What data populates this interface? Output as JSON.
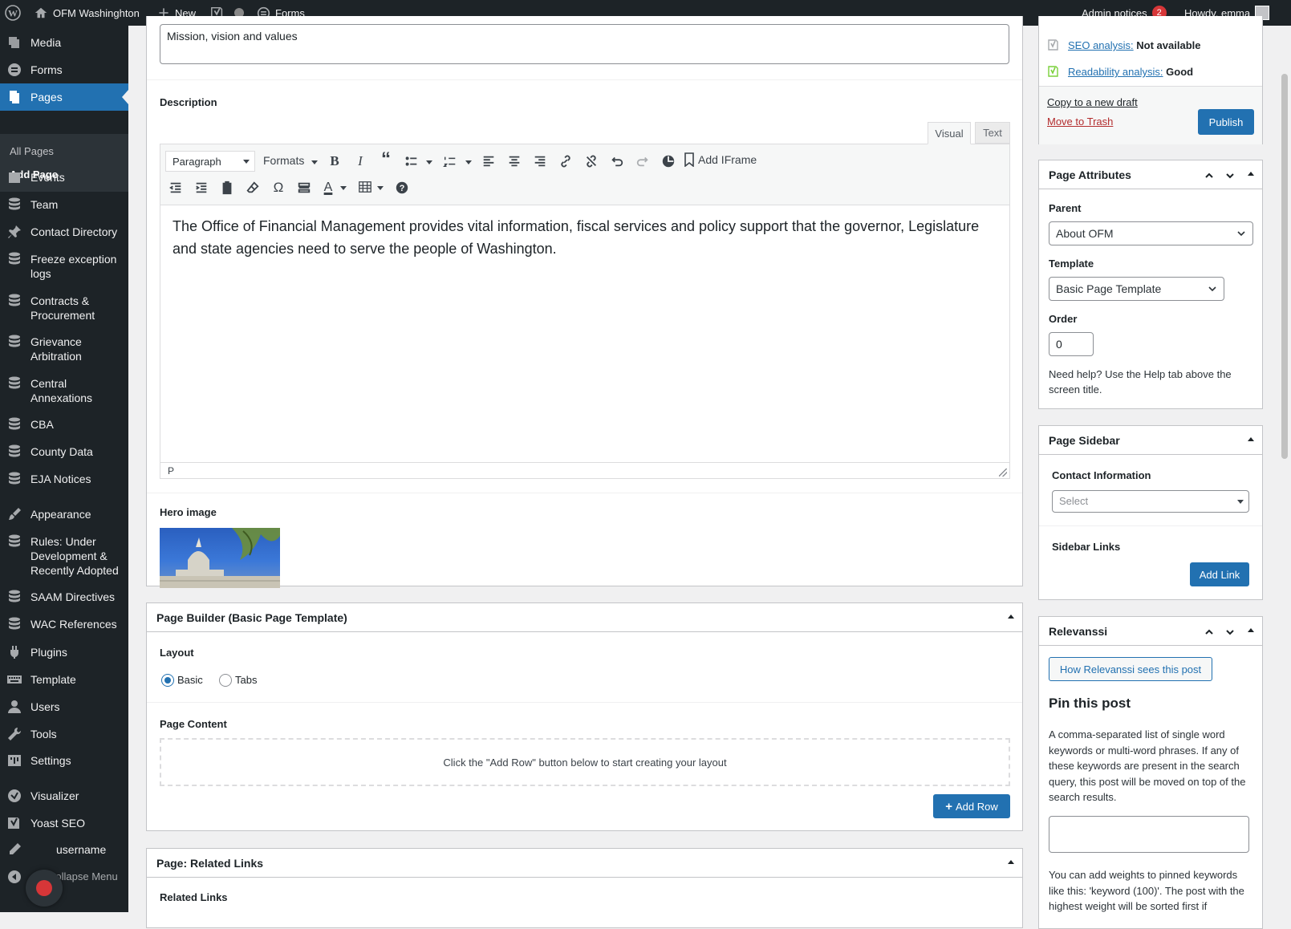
{
  "adminbar": {
    "site_name": "OFM Washinghton",
    "new_label": "New",
    "forms_label": "Forms",
    "admin_notices_label": "Admin notices",
    "admin_notices_count": "2",
    "howdy": "Howdy, emma"
  },
  "sidebar": {
    "media": "Media",
    "forms": "Forms",
    "pages": "Pages",
    "all_pages": "All Pages",
    "add_page": "Add Page",
    "events": "Events",
    "team": "Team",
    "contact_directory": "Contact Directory",
    "freeze_1": "Freeze exception",
    "freeze_2": "logs",
    "contracts_1": "Contracts &",
    "contracts_2": "Procurement",
    "grievance_1": "Grievance",
    "grievance_2": "Arbitration",
    "central_1": "Central",
    "central_2": "Annexations",
    "cba": "CBA",
    "county_data": "County Data",
    "eja_notices": "EJA Notices",
    "appearance": "Appearance",
    "rules_1": "Rules: Under",
    "rules_2": "Development &",
    "rules_3": "Recently Adopted",
    "saam": "SAAM Directives",
    "wac": "WAC References",
    "plugins": "Plugins",
    "template": "Template",
    "users": "Users",
    "tools": "Tools",
    "settings": "Settings",
    "visualizer": "Visualizer",
    "yoast_seo": "Yoast SEO",
    "username": "username",
    "collapse": "Collapse Menu"
  },
  "main": {
    "subtitle_value": "Mission, vision and values",
    "description_label": "Description",
    "tab_visual": "Visual",
    "tab_text": "Text",
    "format_select": "Paragraph",
    "formats_label": "Formats",
    "add_iframe": "Add IFrame",
    "editor_content": "The Office of Financial Management provides vital information, fiscal services and policy support that the governor, Legislature and state agencies need to serve the people of Washington.",
    "status_path": "P",
    "hero_label": "Hero image"
  },
  "page_builder": {
    "title": "Page Builder (Basic Page Template)",
    "layout_label": "Layout",
    "option_basic": "Basic",
    "option_tabs": "Tabs",
    "page_content_label": "Page Content",
    "empty_hint": "Click the \"Add Row\" button below to start creating your layout",
    "add_row": "Add Row"
  },
  "related_links": {
    "title": "Page: Related Links",
    "label": "Related Links"
  },
  "publish": {
    "seo_label": "SEO analysis:",
    "seo_value": "Not available",
    "readability_label": "Readability analysis:",
    "readability_value": "Good",
    "copy_draft": "Copy to a new draft",
    "trash": "Move to Trash",
    "publish_button": "Publish"
  },
  "page_attributes": {
    "title": "Page Attributes",
    "parent_label": "Parent",
    "parent_value": "About OFM",
    "template_label": "Template",
    "template_value": "Basic Page Template",
    "order_label": "Order",
    "order_value": "0",
    "help_text": "Need help? Use the Help tab above the screen title."
  },
  "page_sidebar": {
    "title": "Page Sidebar",
    "contact_label": "Contact Information",
    "contact_placeholder": "Select",
    "links_label": "Sidebar Links",
    "add_link": "Add Link"
  },
  "relevanssi": {
    "title": "Relevanssi",
    "how_button": "How Relevanssi sees this post",
    "pin_heading": "Pin this post",
    "pin_description": "A comma-separated list of single word keywords or multi-word phrases. If any of these keywords are present in the search query, this post will be moved on top of the search results.",
    "weights_note": "You can add weights to pinned keywords like this: 'keyword (100)'. The post with the highest weight will be sorted first if"
  },
  "colors": {
    "admin_bar": "#1d2327",
    "accent": "#2271b1",
    "danger": "#b32d2e",
    "notice_badge": "#d63638",
    "yoast_good": "#7ad03a"
  }
}
